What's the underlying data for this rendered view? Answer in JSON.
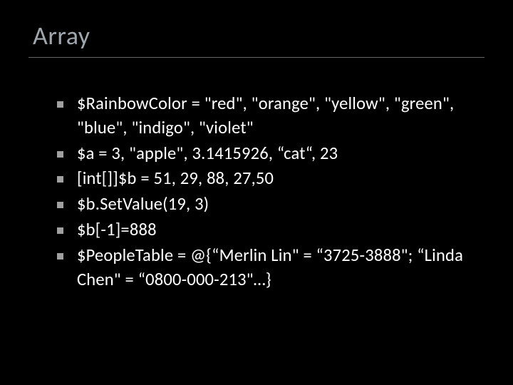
{
  "slide": {
    "title": "Array",
    "bullets": [
      "$RainbowColor = \"red\", \"orange\", \"yellow\", \"green\", \"blue\", \"indigo\", \"violet\"",
      "$a =  3, \"apple\", 3.1415926, “cat“, 23",
      "[int[]]$b = 51, 29, 88, 27,50",
      "$b.SetValue(19, 3)",
      "$b[-1]=888",
      "$PeopleTable = @{“Merlin Lin\" = “3725-3888\"; “Linda Chen\" = “0800-000-213\"…}"
    ]
  }
}
